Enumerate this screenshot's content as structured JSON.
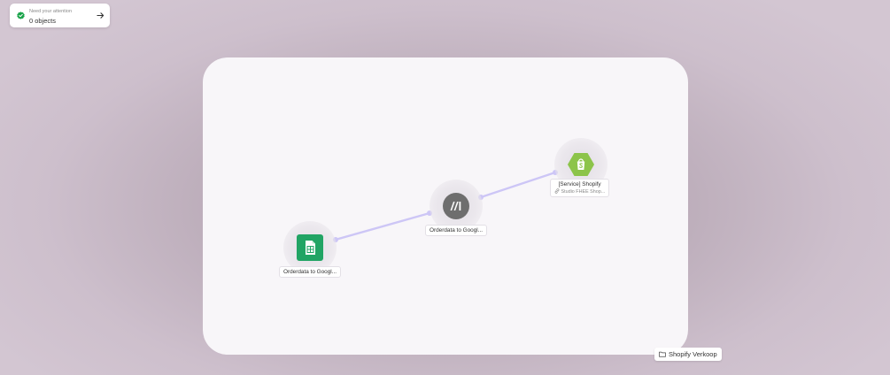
{
  "attention": {
    "label": "Need your attention",
    "count": "0 objects"
  },
  "nodes": [
    {
      "title": "Orderdata to Googl...",
      "app": "Google Sheets",
      "icon": "google-sheets-icon"
    },
    {
      "title": "Orderdata to Googl...",
      "app": "Make",
      "icon": "make-logo-icon"
    },
    {
      "title": "[Service] Shopify",
      "subtitle": "Studio FHEE Shop...",
      "app": "Shopify",
      "icon": "shopify-icon"
    }
  ],
  "folder": {
    "label": "Shopify Verkoop",
    "icon": "folder-icon"
  },
  "colors": {
    "edge": "#cdc6f6",
    "check": "#1aa34a",
    "sheets": "#21a464",
    "make": "#6e6e6e",
    "shopify": "#8cc44a"
  }
}
